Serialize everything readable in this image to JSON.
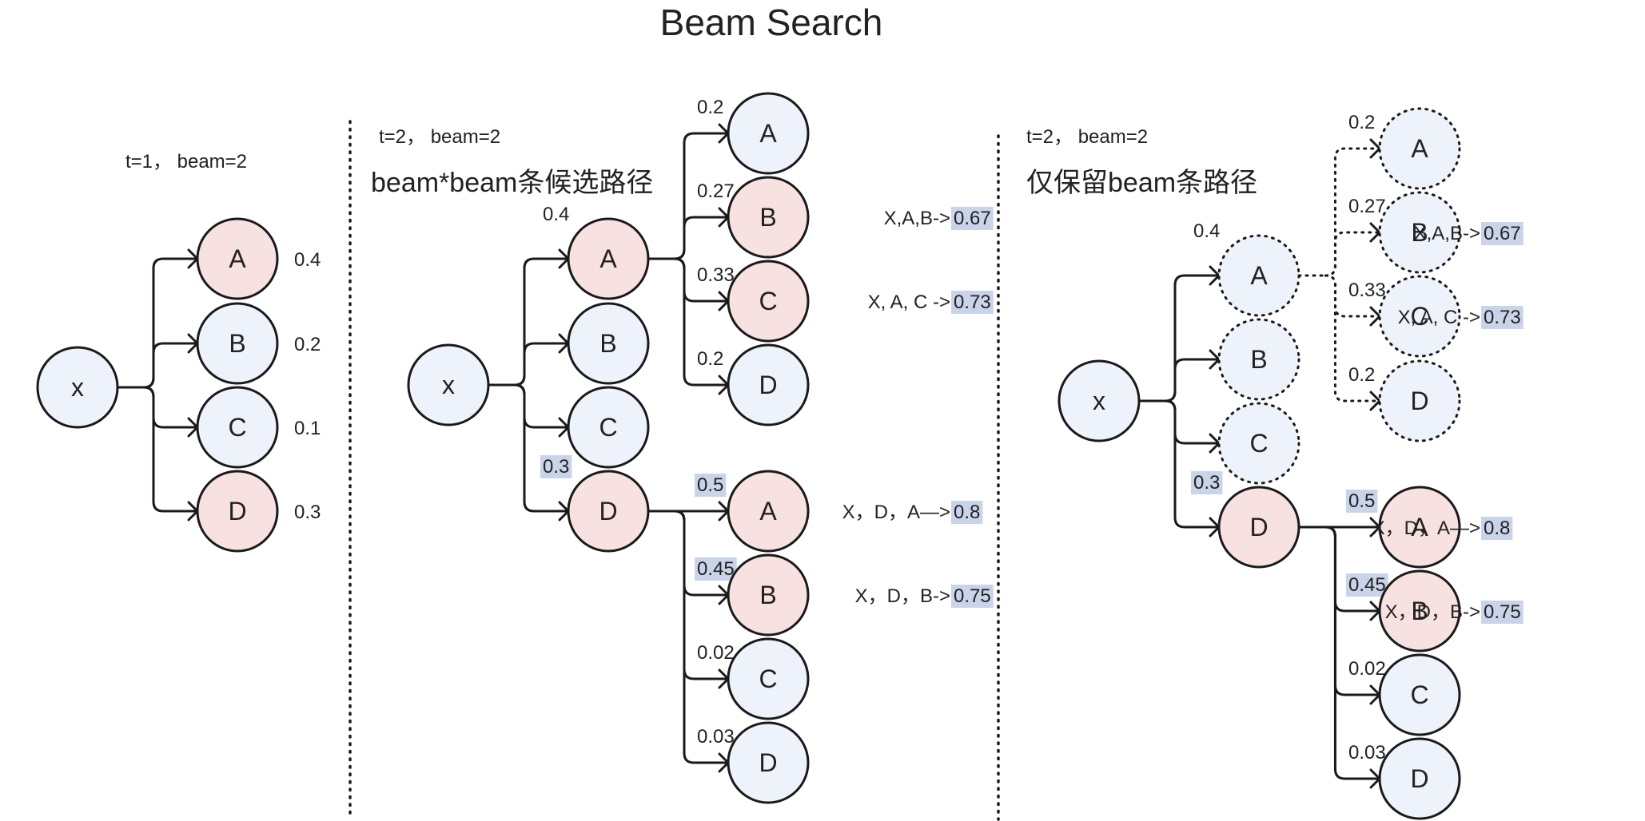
{
  "title": "Beam Search",
  "colors": {
    "pink": "#f8e1e1",
    "blue": "#eef2fa",
    "highlight": "#c9d3ea",
    "stroke": "#1a1a1a"
  },
  "panels": [
    {
      "id": "panel1",
      "caption": "t=1， beam=2",
      "heading": "",
      "root": "x",
      "children": [
        {
          "label": "A",
          "prob": "0.4",
          "fill": "pink",
          "prob_pos": "right"
        },
        {
          "label": "B",
          "prob": "0.2",
          "fill": "blue",
          "prob_pos": "right"
        },
        {
          "label": "C",
          "prob": "0.1",
          "fill": "blue",
          "prob_pos": "right"
        },
        {
          "label": "D",
          "prob": "0.3",
          "fill": "pink",
          "prob_pos": "right"
        }
      ]
    },
    {
      "id": "panel2",
      "caption": "t=2， beam=2",
      "heading": "beam*beam条候选路径",
      "root": "x",
      "children": [
        {
          "label": "A",
          "prob": "0.4",
          "fill": "pink",
          "highlight": false,
          "expansion": [
            {
              "label": "A",
              "prob": "0.2",
              "fill": "blue",
              "path": "",
              "score": ""
            },
            {
              "label": "B",
              "prob": "0.27",
              "fill": "pink",
              "path": "X,A,B->",
              "score": "0.67"
            },
            {
              "label": "C",
              "prob": "0.33",
              "fill": "pink",
              "path": "X, A, C ->",
              "score": "0.73"
            },
            {
              "label": "D",
              "prob": "0.2",
              "fill": "blue",
              "path": "",
              "score": ""
            }
          ]
        },
        {
          "label": "B",
          "prob": "",
          "fill": "blue"
        },
        {
          "label": "C",
          "prob": "",
          "fill": "blue"
        },
        {
          "label": "D",
          "prob": "0.3",
          "fill": "pink",
          "highlight": true,
          "expansion": [
            {
              "label": "A",
              "prob": "0.5",
              "highlight": true,
              "fill": "pink",
              "path": "X，D，A—>",
              "score": "0.8"
            },
            {
              "label": "B",
              "prob": "0.45",
              "highlight": true,
              "fill": "pink",
              "path": "X，D，B->",
              "score": "0.75"
            },
            {
              "label": "C",
              "prob": "0.02",
              "fill": "blue",
              "path": "",
              "score": ""
            },
            {
              "label": "D",
              "prob": "0.03",
              "fill": "blue",
              "path": "",
              "score": ""
            }
          ]
        }
      ]
    },
    {
      "id": "panel3",
      "caption": "t=2， beam=2",
      "heading": "仅保留beam条路径",
      "root": "x",
      "children": [
        {
          "label": "A",
          "prob": "0.4",
          "fill": "blue",
          "dotted": true,
          "expansion": [
            {
              "label": "A",
              "prob": "0.2",
              "fill": "blue",
              "dotted": true,
              "path": "",
              "score": ""
            },
            {
              "label": "B",
              "prob": "0.27",
              "fill": "blue",
              "dotted": true,
              "path": "X,A,B->",
              "score": "0.67"
            },
            {
              "label": "C",
              "prob": "0.33",
              "fill": "blue",
              "dotted": true,
              "path": "X, A, C ->",
              "score": "0.73"
            },
            {
              "label": "D",
              "prob": "0.2",
              "fill": "blue",
              "dotted": true,
              "path": "",
              "score": ""
            }
          ]
        },
        {
          "label": "B",
          "prob": "",
          "fill": "blue",
          "dotted": true
        },
        {
          "label": "C",
          "prob": "",
          "fill": "blue",
          "dotted": true
        },
        {
          "label": "D",
          "prob": "0.3",
          "fill": "pink",
          "highlight": true,
          "expansion": [
            {
              "label": "A",
              "prob": "0.5",
              "highlight": true,
              "fill": "pink",
              "path": "X，D，A—>",
              "score": "0.8"
            },
            {
              "label": "B",
              "prob": "0.45",
              "highlight": true,
              "fill": "pink",
              "path": "X，D，B->",
              "score": "0.75"
            },
            {
              "label": "C",
              "prob": "0.02",
              "fill": "blue",
              "path": "",
              "score": ""
            },
            {
              "label": "D",
              "prob": "0.03",
              "fill": "blue",
              "path": "",
              "score": ""
            }
          ]
        }
      ]
    }
  ]
}
